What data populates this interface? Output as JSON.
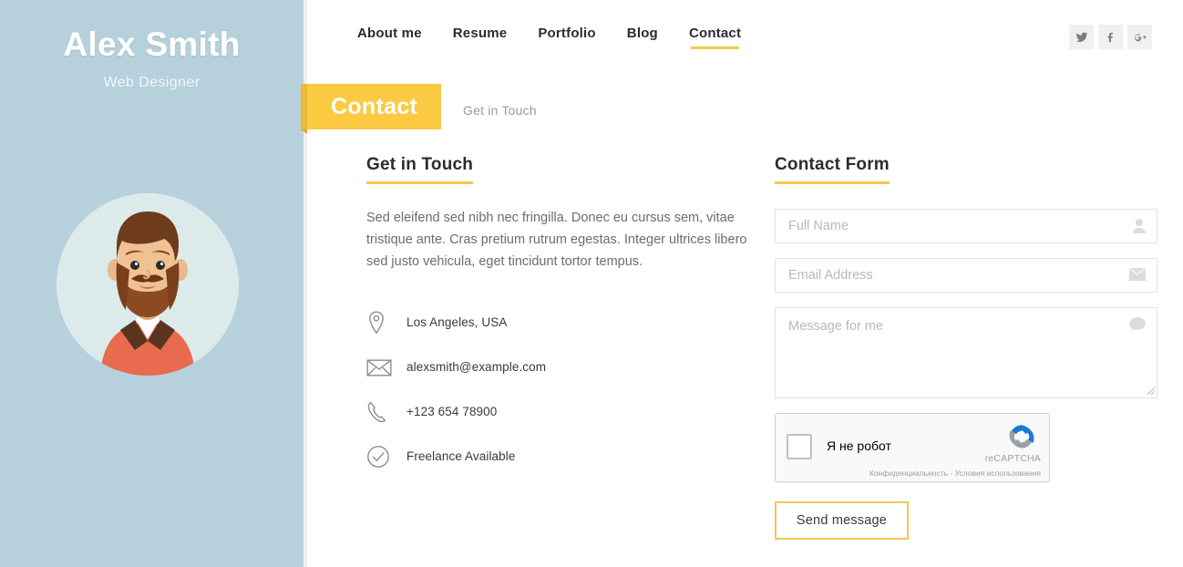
{
  "sidebar": {
    "name": "Alex Smith",
    "role": "Web Designer",
    "avatar_icon": "bearded-man-avatar-illustration",
    "bg_color": "#b6d0dc",
    "avatar_circle_color": "#dceaea"
  },
  "header": {
    "nav": [
      {
        "label": "About me",
        "active": false
      },
      {
        "label": "Resume",
        "active": false
      },
      {
        "label": "Portfolio",
        "active": false
      },
      {
        "label": "Blog",
        "active": false
      },
      {
        "label": "Contact",
        "active": true
      }
    ],
    "socials": [
      {
        "name": "twitter-icon",
        "label": "Twitter"
      },
      {
        "name": "facebook-icon",
        "label": "Facebook"
      },
      {
        "name": "google-plus-icon",
        "label": "Google Plus"
      }
    ],
    "accent_color": "#f2ca4d"
  },
  "banner": {
    "title": "Contact",
    "subtitle": "Get in Touch",
    "bg_color": "#fbca42"
  },
  "left_column": {
    "heading": "Get in Touch",
    "paragraph": "Sed eleifend sed nibh nec fringilla. Donec eu cursus sem, vitae tristique ante. Cras pretium rutrum egestas. Integer ultrices libero sed justo vehicula, eget tincidunt tortor tempus.",
    "details": [
      {
        "icon": "location-pin-icon",
        "text": "Los Angeles, USA"
      },
      {
        "icon": "envelope-icon",
        "text": "alexsmith@example.com"
      },
      {
        "icon": "phone-icon",
        "text": "+123 654 78900"
      },
      {
        "icon": "check-circle-icon",
        "text": "Freelance Available"
      }
    ]
  },
  "right_column": {
    "heading": "Contact Form",
    "fields": {
      "full_name": {
        "placeholder": "Full Name",
        "value": "",
        "icon": "user-icon"
      },
      "email": {
        "placeholder": "Email Address",
        "value": "",
        "icon": "envelope-icon"
      },
      "message": {
        "placeholder": "Message for me",
        "value": "",
        "icon": "speech-bubble-icon"
      }
    },
    "recaptcha": {
      "label": "Я не робот",
      "brand": "reCAPTCHA",
      "terms": "Конфиденциальность - Условия использования",
      "checked": false,
      "logo_icon": "recaptcha-logo-icon"
    },
    "submit_label": "Send message"
  }
}
